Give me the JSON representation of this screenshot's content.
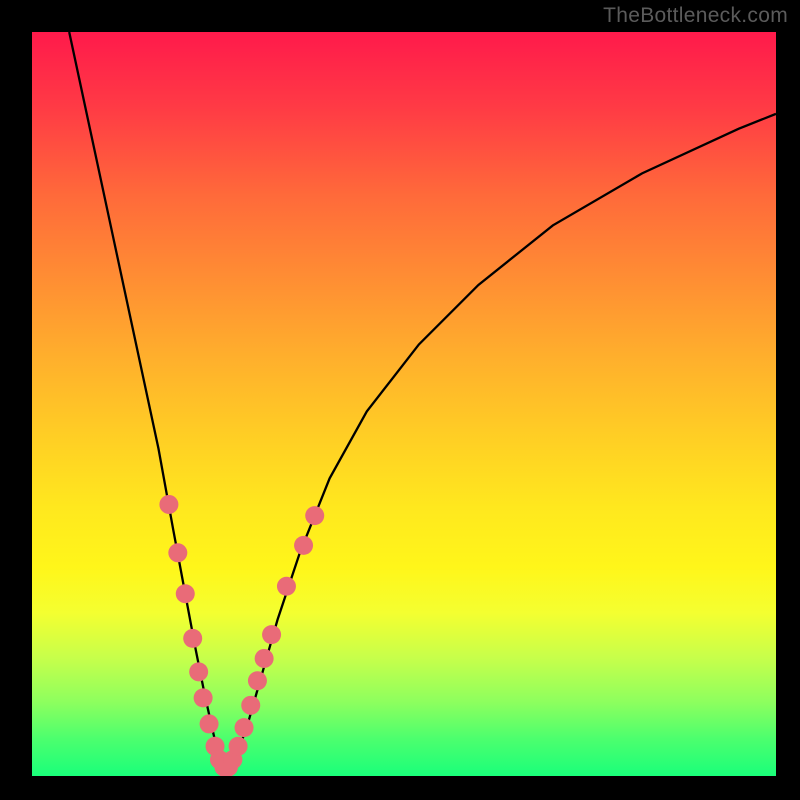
{
  "watermark": "TheBottleneck.com",
  "chart_data": {
    "type": "line",
    "title": "",
    "xlabel": "",
    "ylabel": "",
    "xlim": [
      0,
      100
    ],
    "ylim": [
      0,
      100
    ],
    "series": [
      {
        "name": "curve",
        "x": [
          5,
          8,
          11,
          14,
          17,
          19,
          20.5,
          22,
          23.2,
          24.2,
          25,
          25.8,
          26.6,
          27.6,
          29,
          31,
          33,
          36,
          40,
          45,
          52,
          60,
          70,
          82,
          95,
          100
        ],
        "y": [
          100,
          86,
          72,
          58,
          44,
          33,
          25,
          17,
          11,
          6.5,
          3,
          1.2,
          1.2,
          3,
          7,
          14,
          21,
          30,
          40,
          49,
          58,
          66,
          74,
          81,
          87,
          89
        ]
      }
    ],
    "markers": [
      {
        "x": 18.4,
        "y": 36.5
      },
      {
        "x": 19.6,
        "y": 30.0
      },
      {
        "x": 20.6,
        "y": 24.5
      },
      {
        "x": 21.6,
        "y": 18.5
      },
      {
        "x": 22.4,
        "y": 14.0
      },
      {
        "x": 23.0,
        "y": 10.5
      },
      {
        "x": 23.8,
        "y": 7.0
      },
      {
        "x": 24.6,
        "y": 4.0
      },
      {
        "x": 25.2,
        "y": 2.2
      },
      {
        "x": 25.8,
        "y": 1.2
      },
      {
        "x": 26.4,
        "y": 1.2
      },
      {
        "x": 27.0,
        "y": 2.2
      },
      {
        "x": 27.7,
        "y": 4.0
      },
      {
        "x": 28.5,
        "y": 6.5
      },
      {
        "x": 29.4,
        "y": 9.5
      },
      {
        "x": 30.3,
        "y": 12.8
      },
      {
        "x": 31.2,
        "y": 15.8
      },
      {
        "x": 32.2,
        "y": 19.0
      },
      {
        "x": 34.2,
        "y": 25.5
      },
      {
        "x": 36.5,
        "y": 31.0
      },
      {
        "x": 38.0,
        "y": 35.0
      }
    ],
    "marker_color": "#e96b78",
    "curve_color": "#000000",
    "gradient_stops": [
      {
        "pos": 0,
        "color": "#ff1a4b"
      },
      {
        "pos": 22,
        "color": "#ff6a3a"
      },
      {
        "pos": 55,
        "color": "#ffd024"
      },
      {
        "pos": 78,
        "color": "#f4ff30"
      },
      {
        "pos": 100,
        "color": "#1aff7a"
      }
    ]
  }
}
